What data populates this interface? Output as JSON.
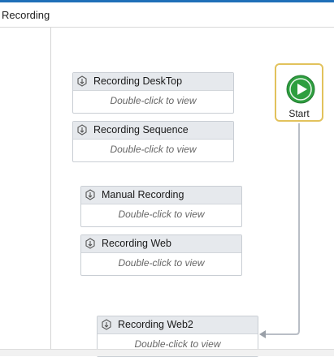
{
  "breadcrumb": {
    "title": "Recording"
  },
  "activities": [
    {
      "title": "Recording DeskTop",
      "hint": "Double-click to view"
    },
    {
      "title": "Recording Sequence",
      "hint": "Double-click to view"
    },
    {
      "title": "Manual Recording",
      "hint": "Double-click to view"
    },
    {
      "title": "Recording Web",
      "hint": "Double-click to view"
    },
    {
      "title": "Recording Web2",
      "hint": "Double-click to view"
    }
  ],
  "start_node": {
    "label": "Start",
    "icon": "play-icon"
  },
  "colors": {
    "accent": "#1f6fb8",
    "start_green": "#2e9e3f",
    "start_border": "#e2c25c",
    "activity_header": "#e6e9ed",
    "connector": "#b9bec6"
  }
}
